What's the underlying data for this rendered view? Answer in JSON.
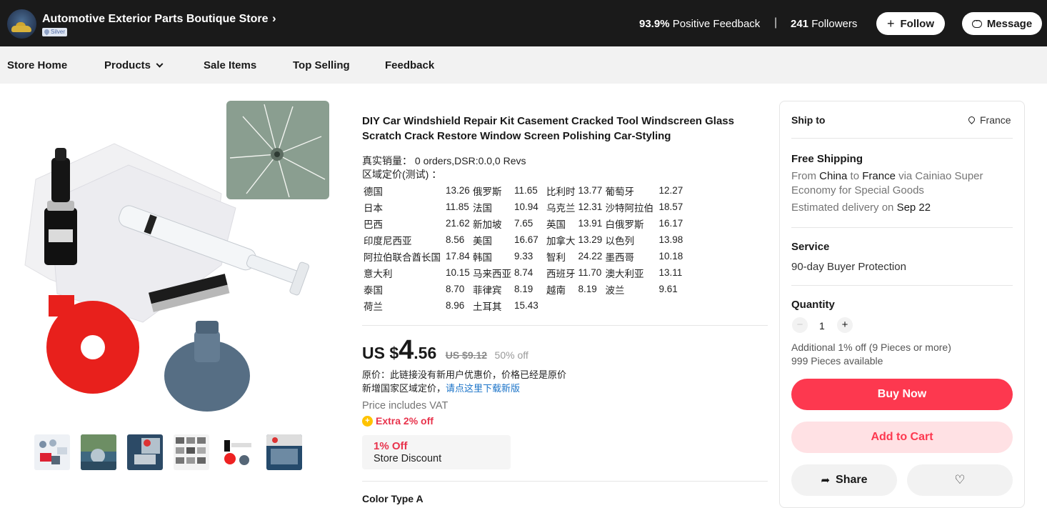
{
  "store": {
    "name": "Automotive Exterior Parts Boutique Store",
    "chevron": "›",
    "badge": "Silver",
    "feedback_value": "93.9%",
    "feedback_label": "Positive Feedback",
    "separator": "|",
    "followers_value": "241",
    "followers_label": "Followers",
    "follow_label": "Follow",
    "message_label": "Message"
  },
  "nav": {
    "items": [
      {
        "label": "Store Home"
      },
      {
        "label": "Products"
      },
      {
        "label": "Sale Items"
      },
      {
        "label": "Top Selling"
      },
      {
        "label": "Feedback"
      }
    ]
  },
  "gallery": {
    "thumbnail_count": 6
  },
  "product": {
    "title": "DIY Car Windshield Repair Kit Casement Cracked Tool Windscreen Glass Scratch Crack Restore Window Screen Polishing Car-Styling",
    "sales_line": "真实销量：   0 orders,DSR:0.0,0 Revs",
    "region_line": "区域定价(测试) ：",
    "region_prices": [
      [
        "德国",
        "13.26",
        "俄罗斯",
        "11.65",
        "比利时",
        "13.77",
        "葡萄牙",
        "12.27"
      ],
      [
        "日本",
        "11.85",
        "法国",
        "10.94",
        "乌克兰",
        "12.31",
        "沙特阿拉伯",
        "18.57"
      ],
      [
        "巴西",
        "21.62",
        "新加坡",
        "7.65",
        "英国",
        "13.91",
        "白俄罗斯",
        "16.17"
      ],
      [
        "印度尼西亚",
        "8.56",
        "美国",
        "16.67",
        "加拿大",
        "13.29",
        "以色列",
        "13.98"
      ],
      [
        "阿拉伯联合酋长国",
        "17.84",
        "韩国",
        "9.33",
        "智利",
        "24.22",
        "墨西哥",
        "10.18"
      ],
      [
        "意大利",
        "10.15",
        "马来西亚",
        "8.74",
        "西班牙",
        "11.70",
        "澳大利亚",
        "13.11"
      ],
      [
        "泰国",
        "8.70",
        "菲律宾",
        "8.19",
        "越南",
        "8.19",
        "波兰",
        "9.61"
      ],
      [
        "荷兰",
        "8.96",
        "土耳其",
        "15.43",
        "",
        "",
        "",
        ""
      ]
    ],
    "price_currency": "US $",
    "price_int": "4",
    "price_cents": ".56",
    "original_price": "US $9.12",
    "discount_pct": "50% off",
    "orig_note": "原价：此链接没有新用户优惠价，价格已经是原价",
    "region_note": "新增国家区域定价，",
    "region_note_link": "请点这里下载新版",
    "vat_note": "Price includes VAT",
    "extra_off": "Extra 2% off",
    "store_discount_pct": "1% Off",
    "store_discount_label": "Store Discount",
    "color_type": "Color Type A"
  },
  "shipping": {
    "ship_to_label": "Ship to",
    "ship_to_value": "France",
    "free_shipping": "Free Shipping",
    "route_from": "From",
    "route_origin": "China",
    "route_to": "to",
    "route_dest": "France",
    "route_via": "via Cainiao Super",
    "route_via2": "Economy for Special Goods",
    "delivery_prefix": "Estimated delivery on",
    "delivery_date": "Sep 22",
    "service_label": "Service",
    "service_value": "90-day Buyer Protection",
    "quantity_label": "Quantity",
    "quantity_value": "1",
    "qty_minus": "−",
    "qty_plus": "+",
    "additional_off": "Additional 1% off (9 Pieces or more)",
    "available": "999 Pieces available",
    "buy_now": "Buy Now",
    "add_to_cart": "Add to Cart",
    "share": "Share"
  },
  "colors": {
    "accent": "#fd384f",
    "accent_light": "#ffe1e4",
    "header_bg": "#1a1a1a",
    "link": "#1a73c8"
  },
  "icons": {
    "follow": "plus-icon",
    "message": "chat-bubble-icon",
    "ship_to": "location-pin-icon",
    "share": "share-arrow-icon",
    "wishlist": "heart-icon",
    "extra_off": "coin-icon"
  }
}
